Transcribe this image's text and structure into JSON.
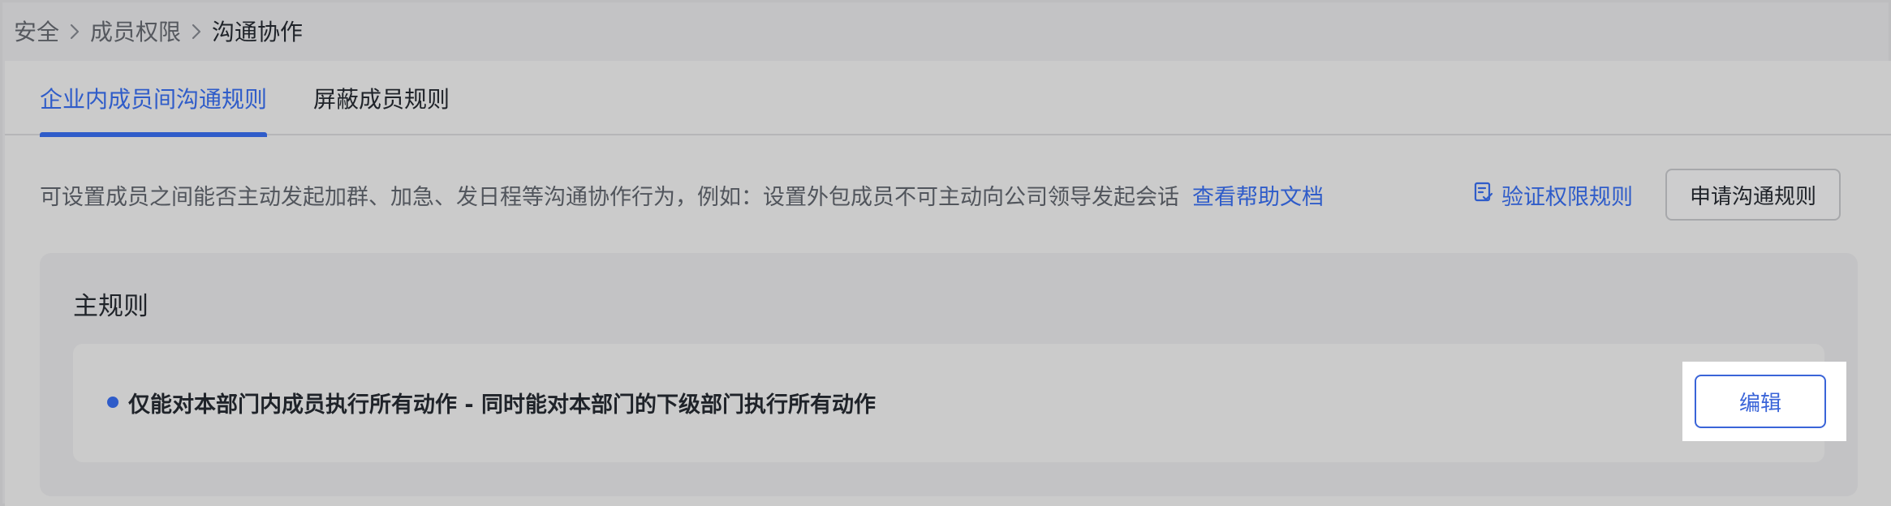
{
  "breadcrumb": {
    "items": [
      "安全",
      "成员权限",
      "沟通协作"
    ]
  },
  "tabs": [
    {
      "label": "企业内成员间沟通规则",
      "active": true
    },
    {
      "label": "屏蔽成员规则",
      "active": false
    }
  ],
  "description": {
    "text": "可设置成员之间能否主动发起加群、加急、发日程等沟通协作行为，例如：设置外包成员不可主动向公司领导发起会话",
    "help_link": "查看帮助文档"
  },
  "actions": {
    "verify_label": "验证权限规则",
    "verify_icon": "document-check-icon",
    "apply_label": "申请沟通规则"
  },
  "main_rule": {
    "title": "主规则",
    "rule_text": "仅能对本部门内成员执行所有动作 - 同时能对本部门的下级部门执行所有动作",
    "edit_label": "编辑"
  },
  "colors": {
    "accent": "#2f5cc9",
    "background": "#c3c3c5",
    "panel": "#cbcbcb"
  }
}
